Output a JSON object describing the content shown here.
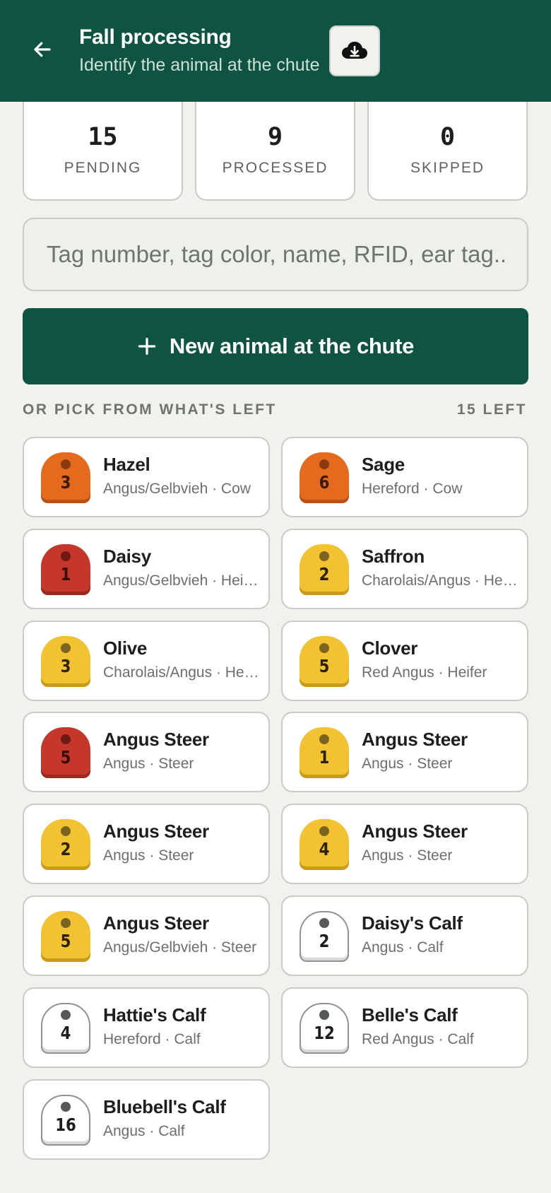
{
  "header": {
    "title": "Fall processing",
    "subtitle": "Identify the animal at the chute",
    "back_icon": "arrow-left-icon",
    "download_icon": "cloud-download-icon"
  },
  "stats": [
    {
      "value": "15",
      "label": "PENDING"
    },
    {
      "value": "9",
      "label": "PROCESSED"
    },
    {
      "value": "0",
      "label": "SKIPPED"
    }
  ],
  "search": {
    "placeholder": "Tag number, tag color, name, RFID, ear tag..."
  },
  "new_button": {
    "label": "New animal at the chute",
    "icon": "plus-icon"
  },
  "section": {
    "label": "OR PICK FROM WHAT'S LEFT",
    "count": "15 LEFT"
  },
  "animals": [
    {
      "name": "Hazel",
      "meta": "Angus/Gelbvieh · Cow",
      "tag": "3",
      "tag_color": "orange"
    },
    {
      "name": "Sage",
      "meta": "Hereford · Cow",
      "tag": "6",
      "tag_color": "orange"
    },
    {
      "name": "Daisy",
      "meta": "Angus/Gelbvieh · Heifer",
      "tag": "1",
      "tag_color": "red"
    },
    {
      "name": "Saffron",
      "meta": "Charolais/Angus · Heifer",
      "tag": "2",
      "tag_color": "yellow"
    },
    {
      "name": "Olive",
      "meta": "Charolais/Angus · Heifer",
      "tag": "3",
      "tag_color": "yellow"
    },
    {
      "name": "Clover",
      "meta": "Red Angus · Heifer",
      "tag": "5",
      "tag_color": "yellow"
    },
    {
      "name": "Angus Steer",
      "meta": "Angus · Steer",
      "tag": "5",
      "tag_color": "red"
    },
    {
      "name": "Angus Steer",
      "meta": "Angus · Steer",
      "tag": "1",
      "tag_color": "yellow"
    },
    {
      "name": "Angus Steer",
      "meta": "Angus · Steer",
      "tag": "2",
      "tag_color": "yellow"
    },
    {
      "name": "Angus Steer",
      "meta": "Angus · Steer",
      "tag": "4",
      "tag_color": "yellow"
    },
    {
      "name": "Angus Steer",
      "meta": "Angus/Gelbvieh · Steer",
      "tag": "5",
      "tag_color": "yellow"
    },
    {
      "name": "Daisy's Calf",
      "meta": "Angus · Calf",
      "tag": "2",
      "tag_color": "white"
    },
    {
      "name": "Hattie's Calf",
      "meta": "Hereford · Calf",
      "tag": "4",
      "tag_color": "white"
    },
    {
      "name": "Belle's Calf",
      "meta": "Red Angus · Calf",
      "tag": "12",
      "tag_color": "white"
    },
    {
      "name": "Bluebell's Calf",
      "meta": "Angus · Calf",
      "tag": "16",
      "tag_color": "white"
    }
  ]
}
